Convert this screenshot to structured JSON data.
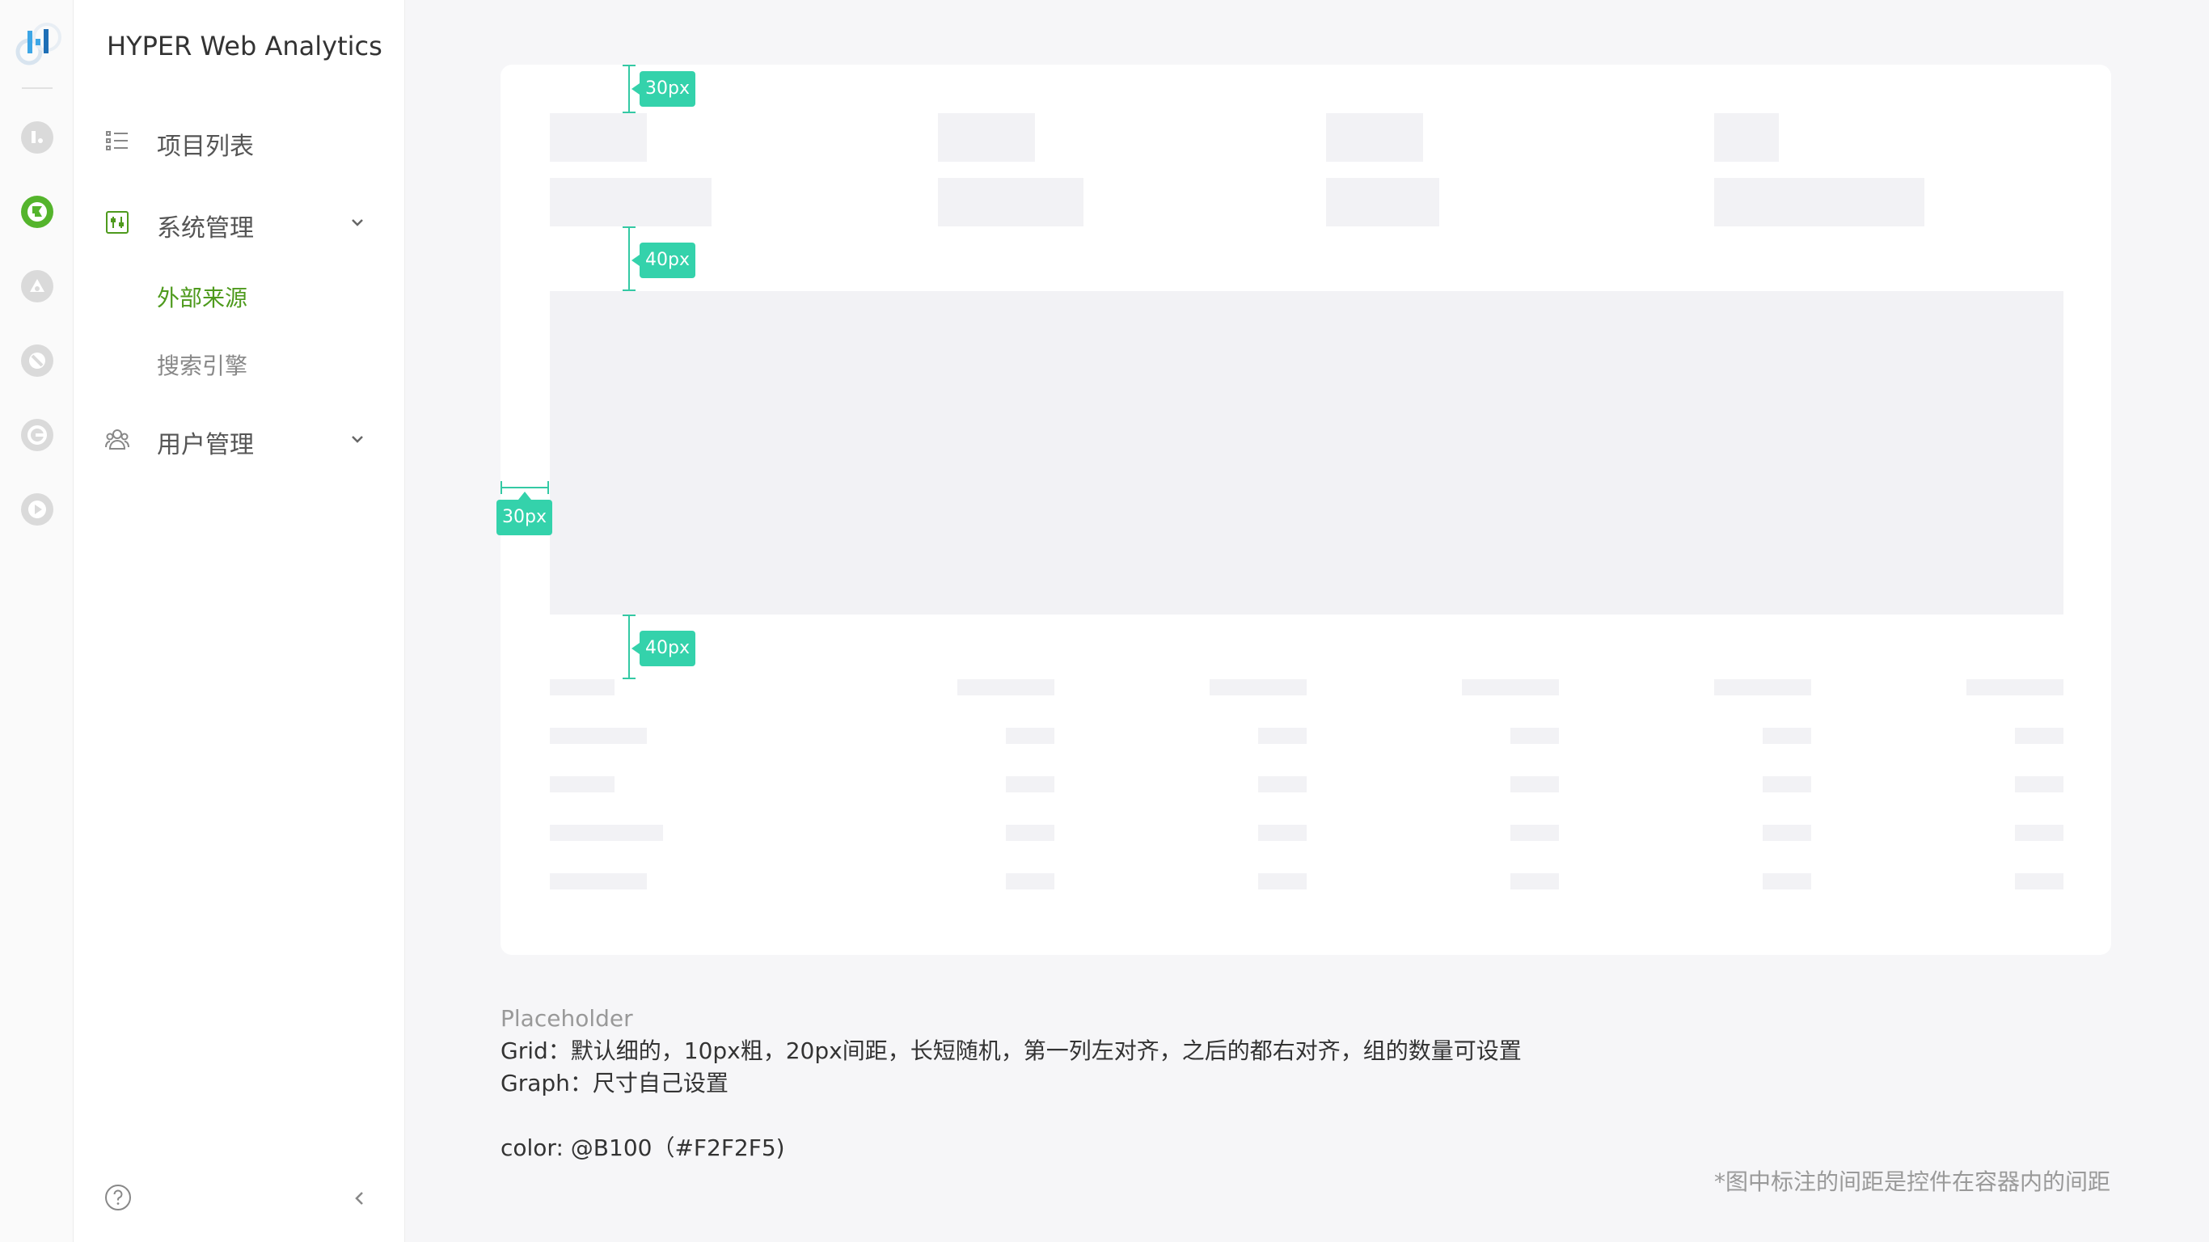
{
  "app": {
    "title": "HYPER Web Analytics"
  },
  "rail": {
    "icons": [
      "analytics-icon",
      "flag-icon",
      "triangle-icon",
      "slash-circle-icon",
      "refresh-circle-icon",
      "play-circle-icon"
    ],
    "active_color": "#54B42C"
  },
  "sidebar": {
    "items": [
      {
        "label": "项目列表",
        "icon": "list-icon"
      },
      {
        "label": "系统管理",
        "icon": "settings-panel-icon",
        "expanded": true,
        "children": [
          {
            "label": "外部来源",
            "active": true
          },
          {
            "label": "搜索引擎"
          }
        ]
      },
      {
        "label": "用户管理",
        "icon": "users-icon",
        "expanded": false
      }
    ],
    "accent_color": "#4E9A1D"
  },
  "annotations": {
    "top_padding": "30px",
    "summary_gap": "40px",
    "left_padding": "30px",
    "graph_gap": "40px"
  },
  "notes": {
    "title": "Placeholder",
    "grid": "Grid：默认细的，10px粗，20px间距，长短随机，第一列左对齐，之后的都右对齐，组的数量可设置",
    "graph": "Graph：尺寸自己设置",
    "color": "color: @B100（#F2F2F5)",
    "footnote": "*图中标注的间距是控件在容器内的间距"
  },
  "colors": {
    "placeholder": "#F2F2F5",
    "annotation": "#34D2AB"
  }
}
